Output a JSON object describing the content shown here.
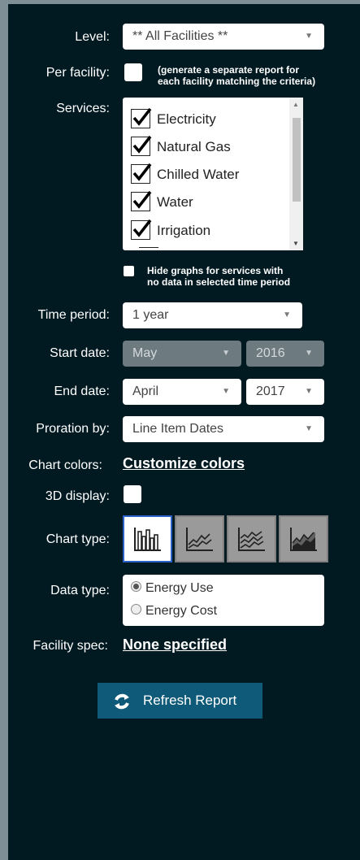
{
  "level": {
    "label": "Level:",
    "value": "** All Facilities **"
  },
  "per_facility": {
    "label": "Per facility:",
    "note_line1": "(generate a separate report for",
    "note_line2": "each facility matching the criteria)"
  },
  "services": {
    "label": "Services:",
    "items": [
      {
        "label": "Electricity",
        "checked": true
      },
      {
        "label": "Natural Gas",
        "checked": true
      },
      {
        "label": "Chilled Water",
        "checked": true
      },
      {
        "label": "Water",
        "checked": true
      },
      {
        "label": "Irrigation",
        "checked": true
      }
    ],
    "hide_note_line1": "Hide graphs for services with",
    "hide_note_line2": "no data in selected time period"
  },
  "time_period": {
    "label": "Time period:",
    "value": "1 year"
  },
  "start_date": {
    "label": "Start date:",
    "month": "May",
    "year": "2016"
  },
  "end_date": {
    "label": "End date:",
    "month": "April",
    "year": "2017"
  },
  "proration": {
    "label": "Proration by:",
    "value": "Line Item Dates"
  },
  "chart_colors": {
    "label": "Chart colors:",
    "link": "Customize colors"
  },
  "display_3d": {
    "label": "3D display:"
  },
  "chart_type": {
    "label": "Chart type:",
    "options": [
      "bar-chart-icon",
      "line-chart-icon",
      "multi-line-chart-icon",
      "area-chart-icon"
    ],
    "selected": 0
  },
  "data_type": {
    "label": "Data type:",
    "options": [
      "Energy Use",
      "Energy Cost"
    ],
    "selected": "Energy Use"
  },
  "facility_spec": {
    "label": "Facility spec:",
    "link": "None specified"
  },
  "refresh": {
    "label": "Refresh Report"
  },
  "colors": {
    "panel": "#011a22",
    "button": "#0e5a78",
    "selected_border": "#2b62c9"
  }
}
